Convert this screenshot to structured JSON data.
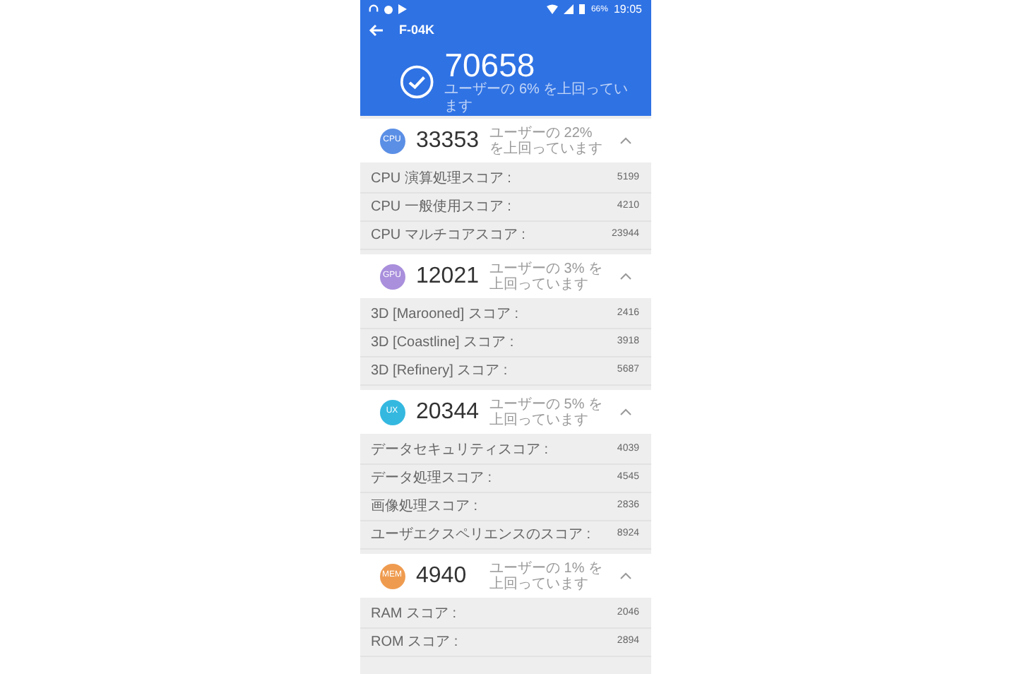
{
  "status_bar": {
    "battery": "66%",
    "time": "19:05"
  },
  "header": {
    "title": "F-04K",
    "score": "70658",
    "subtitle": "ユーザーの 6% を上回っています"
  },
  "sections": [
    {
      "badge": "CPU",
      "color": "#5b8fe6",
      "score": "33353",
      "subtitle": "ユーザーの 22% を上回っています",
      "expanded": true,
      "items": [
        {
          "label": "CPU 演算処理スコア :",
          "value": "5199"
        },
        {
          "label": "CPU 一般使用スコア :",
          "value": "4210"
        },
        {
          "label": "CPU マルチコアスコア :",
          "value": "23944"
        }
      ]
    },
    {
      "badge": "GPU",
      "color": "#a98fdc",
      "score": "12021",
      "subtitle": "ユーザーの 3% を上回っています",
      "expanded": true,
      "items": [
        {
          "label": "3D [Marooned] スコア :",
          "value": "2416"
        },
        {
          "label": "3D [Coastline] スコア :",
          "value": "3918"
        },
        {
          "label": "3D [Refinery] スコア :",
          "value": "5687"
        }
      ]
    },
    {
      "badge": "UX",
      "color": "#34b8e0",
      "score": "20344",
      "subtitle": "ユーザーの 5% を上回っています",
      "expanded": true,
      "items": [
        {
          "label": "データセキュリティスコア :",
          "value": "4039"
        },
        {
          "label": "データ処理スコア :",
          "value": "4545"
        },
        {
          "label": "画像処理スコア :",
          "value": "2836"
        },
        {
          "label": "ユーザエクスペリエンスのスコア :",
          "value": "8924"
        }
      ]
    },
    {
      "badge": "MEM",
      "color": "#ef9b4f",
      "score": "4940",
      "subtitle": "ユーザーの 1% を上回っています",
      "expanded": true,
      "items": [
        {
          "label": "RAM スコア :",
          "value": "2046"
        },
        {
          "label": "ROM スコア :",
          "value": "2894"
        }
      ]
    }
  ]
}
